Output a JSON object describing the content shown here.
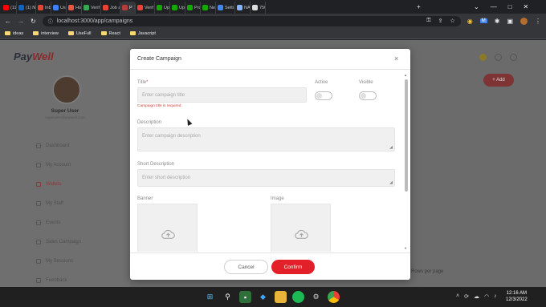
{
  "browser": {
    "tabs": [
      {
        "label": "(11)",
        "favicon_color": "#ff0000"
      },
      {
        "label": "(1) N",
        "favicon_color": "#0a66c2"
      },
      {
        "label": "Inbo",
        "favicon_color": "#ea4335"
      },
      {
        "label": "Usen",
        "favicon_color": "#3b82f6"
      },
      {
        "label": "How",
        "favicon_color": "#e9573f"
      },
      {
        "label": "Verif",
        "favicon_color": "#34a853"
      },
      {
        "label": "Job a",
        "favicon_color": "#ea4335"
      },
      {
        "label": "P",
        "favicon_color": "#b93a3a"
      },
      {
        "label": "Verif",
        "favicon_color": "#ea4335"
      },
      {
        "label": "Upw",
        "favicon_color": "#14a800"
      },
      {
        "label": "Upw",
        "favicon_color": "#14a800"
      },
      {
        "label": "Prop",
        "favicon_color": "#14a800"
      },
      {
        "label": "New",
        "favicon_color": "#14a800"
      },
      {
        "label": "Setti",
        "favicon_color": "#4285f4"
      },
      {
        "label": "NAR",
        "favicon_color": "#8ab4f8"
      },
      {
        "label": "750",
        "favicon_color": "#dddddd"
      }
    ],
    "new_tab": "+",
    "window_controls": [
      "⌄",
      "—",
      "□",
      "✕"
    ],
    "url": "localhost:3000/app/campaigns",
    "toolbar_icons": [
      "key-icon",
      "share-icon",
      "star-icon",
      "extension-icon"
    ],
    "bookmarks": [
      "ideas",
      "interview",
      "UseFull",
      "React",
      "Javacript"
    ]
  },
  "app": {
    "logo_main": "Pay",
    "logo_accent": "Well",
    "user_name": "Super User",
    "user_email": "superuser@paywell.com",
    "nav_items": [
      "Dashboard",
      "My Account",
      "Wallets",
      "My Staff",
      "Events",
      "Sales Campaign",
      "My Sessions",
      "Feedback"
    ],
    "active_nav_index": 2,
    "add_button": "+ Add",
    "rows_per_page": "Rows per page"
  },
  "modal": {
    "title": "Create Campaign",
    "close": "×",
    "title_label": "Title",
    "title_required_mark": "*",
    "title_placeholder": "Enter campaign title",
    "title_error": "Campaign title is required",
    "active_label": "Active",
    "visible_label": "Visible",
    "active_on": false,
    "visible_on": false,
    "description_label": "Description",
    "description_placeholder": "Enter campaign description",
    "short_description_label": "Short Description",
    "short_description_placeholder": "Enter short description",
    "banner_label": "Banner",
    "image_label": "Image",
    "cancel": "Cancel",
    "confirm": "Confirm"
  },
  "taskbar": {
    "time": "12:16 AM",
    "date": "12/3/2022",
    "apps": [
      "start-icon",
      "search-icon",
      "photos-icon",
      "vscode-icon",
      "explorer-icon",
      "spotify-icon",
      "settings-icon",
      "chrome-icon"
    ]
  },
  "colors": {
    "brand_red": "#e3202a",
    "error_red": "#d93a3a",
    "browser_dark": "#202124",
    "toolbar_gray": "#35363a"
  }
}
